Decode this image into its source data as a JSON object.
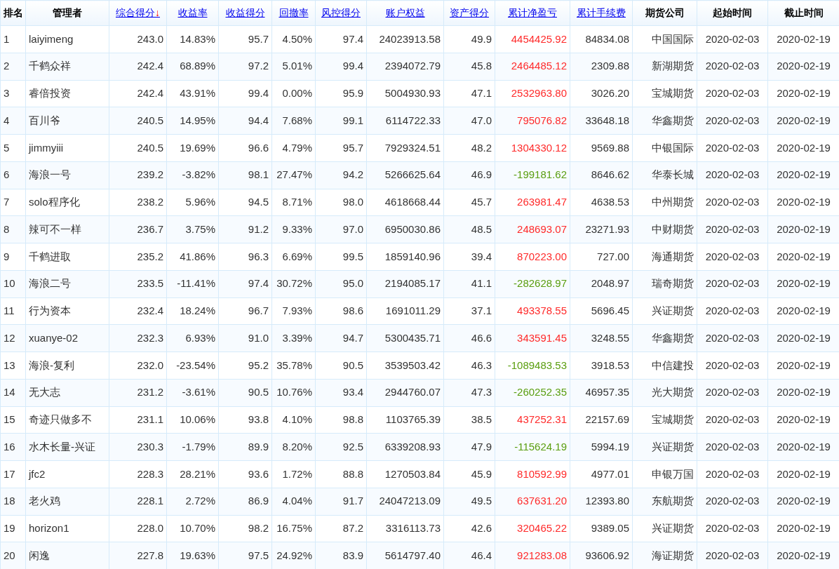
{
  "table": {
    "columns": [
      {
        "label": "排名",
        "link": false
      },
      {
        "label": "管理者",
        "link": false
      },
      {
        "label": "综合得分",
        "link": true,
        "sort_arrow": "↓"
      },
      {
        "label": "收益率",
        "link": true
      },
      {
        "label": "收益得分",
        "link": true
      },
      {
        "label": "回撤率",
        "link": true
      },
      {
        "label": "风控得分",
        "link": true
      },
      {
        "label": "账户权益",
        "link": true
      },
      {
        "label": "资产得分",
        "link": true
      },
      {
        "label": "累计净盈亏",
        "link": true
      },
      {
        "label": "累计手续费",
        "link": true
      },
      {
        "label": "期货公司",
        "link": false
      },
      {
        "label": "起始时间",
        "link": false
      },
      {
        "label": "截止时间",
        "link": false
      }
    ],
    "rows": [
      {
        "cells": [
          "1",
          "laiyimeng",
          "243.0",
          "14.83%",
          "95.7",
          "4.50%",
          "97.4",
          "24023913.58",
          "49.9",
          "4454425.92",
          "84834.08",
          "中国国际",
          "2020-02-03",
          "2020-02-19"
        ],
        "color": "#ff2a2a"
      },
      {
        "cells": [
          "2",
          "千鹤众祥",
          "242.4",
          "68.89%",
          "97.2",
          "5.01%",
          "99.4",
          "2394072.79",
          "45.8",
          "2464485.12",
          "2309.88",
          "新湖期货",
          "2020-02-03",
          "2020-02-19"
        ],
        "color": "#ff2a2a"
      },
      {
        "cells": [
          "3",
          "睿倍投资",
          "242.4",
          "43.91%",
          "99.4",
          "0.00%",
          "95.9",
          "5004930.93",
          "47.1",
          "2532963.80",
          "3026.20",
          "宝城期货",
          "2020-02-03",
          "2020-02-19"
        ],
        "color": "#ff2a2a"
      },
      {
        "cells": [
          "4",
          "百川爷",
          "240.5",
          "14.95%",
          "94.4",
          "7.68%",
          "99.1",
          "6114722.33",
          "47.0",
          "795076.82",
          "33648.18",
          "华鑫期货",
          "2020-02-03",
          "2020-02-19"
        ],
        "color": "#ff2a2a"
      },
      {
        "cells": [
          "5",
          "jimmyiii",
          "240.5",
          "19.69%",
          "96.6",
          "4.79%",
          "95.7",
          "7929324.51",
          "48.2",
          "1304330.12",
          "9569.88",
          "中银国际",
          "2020-02-03",
          "2020-02-19"
        ],
        "color": "#ff2a2a"
      },
      {
        "cells": [
          "6",
          "海浪一号",
          "239.2",
          "-3.82%",
          "98.1",
          "27.47%",
          "94.2",
          "5266625.64",
          "46.9",
          "-199181.62",
          "8646.62",
          "华泰长城",
          "2020-02-03",
          "2020-02-19"
        ],
        "color": "#5a9e0f"
      },
      {
        "cells": [
          "7",
          "solo程序化",
          "238.2",
          "5.96%",
          "94.5",
          "8.71%",
          "98.0",
          "4618668.44",
          "45.7",
          "263981.47",
          "4638.53",
          "中州期货",
          "2020-02-03",
          "2020-02-19"
        ],
        "color": "#ff2a2a"
      },
      {
        "cells": [
          "8",
          "辣可不一样",
          "236.7",
          "3.75%",
          "91.2",
          "9.33%",
          "97.0",
          "6950030.86",
          "48.5",
          "248693.07",
          "23271.93",
          "中财期货",
          "2020-02-03",
          "2020-02-19"
        ],
        "color": "#ff2a2a"
      },
      {
        "cells": [
          "9",
          "千鹤进取",
          "235.2",
          "41.86%",
          "96.3",
          "6.69%",
          "99.5",
          "1859140.96",
          "39.4",
          "870223.00",
          "727.00",
          "海通期货",
          "2020-02-03",
          "2020-02-19"
        ],
        "color": "#ff2a2a"
      },
      {
        "cells": [
          "10",
          "海浪二号",
          "233.5",
          "-11.41%",
          "97.4",
          "30.72%",
          "95.0",
          "2194085.17",
          "41.1",
          "-282628.97",
          "2048.97",
          "瑞奇期货",
          "2020-02-03",
          "2020-02-19"
        ],
        "color": "#5a9e0f"
      },
      {
        "cells": [
          "11",
          "行为资本",
          "232.4",
          "18.24%",
          "96.7",
          "7.93%",
          "98.6",
          "1691011.29",
          "37.1",
          "493378.55",
          "5696.45",
          "兴证期货",
          "2020-02-03",
          "2020-02-19"
        ],
        "color": "#ff2a2a"
      },
      {
        "cells": [
          "12",
          "xuanye-02",
          "232.3",
          "6.93%",
          "91.0",
          "3.39%",
          "94.7",
          "5300435.71",
          "46.6",
          "343591.45",
          "3248.55",
          "华鑫期货",
          "2020-02-03",
          "2020-02-19"
        ],
        "color": "#ff2a2a"
      },
      {
        "cells": [
          "13",
          "海浪-复利",
          "232.0",
          "-23.54%",
          "95.2",
          "35.78%",
          "90.5",
          "3539503.42",
          "46.3",
          "-1089483.53",
          "3918.53",
          "中信建投",
          "2020-02-03",
          "2020-02-19"
        ],
        "color": "#5a9e0f"
      },
      {
        "cells": [
          "14",
          "无大志",
          "231.2",
          "-3.61%",
          "90.5",
          "10.76%",
          "93.4",
          "2944760.07",
          "47.3",
          "-260252.35",
          "46957.35",
          "光大期货",
          "2020-02-03",
          "2020-02-19"
        ],
        "color": "#5a9e0f"
      },
      {
        "cells": [
          "15",
          "奇迹只做多不",
          "231.1",
          "10.06%",
          "93.8",
          "4.10%",
          "98.8",
          "1103765.39",
          "38.5",
          "437252.31",
          "22157.69",
          "宝城期货",
          "2020-02-03",
          "2020-02-19"
        ],
        "color": "#ff2a2a"
      },
      {
        "cells": [
          "16",
          "水木长量-兴证",
          "230.3",
          "-1.79%",
          "89.9",
          "8.20%",
          "92.5",
          "6339208.93",
          "47.9",
          "-115624.19",
          "5994.19",
          "兴证期货",
          "2020-02-03",
          "2020-02-19"
        ],
        "color": "#5a9e0f"
      },
      {
        "cells": [
          "17",
          "jfc2",
          "228.3",
          "28.21%",
          "93.6",
          "1.72%",
          "88.8",
          "1270503.84",
          "45.9",
          "810592.99",
          "4977.01",
          "申银万国",
          "2020-02-03",
          "2020-02-19"
        ],
        "color": "#ff2a2a"
      },
      {
        "cells": [
          "18",
          "老火鸡",
          "228.1",
          "2.72%",
          "86.9",
          "4.04%",
          "91.7",
          "24047213.09",
          "49.5",
          "637631.20",
          "12393.80",
          "东航期货",
          "2020-02-03",
          "2020-02-19"
        ],
        "color": "#ff2a2a"
      },
      {
        "cells": [
          "19",
          "horizon1",
          "228.0",
          "10.70%",
          "98.2",
          "16.75%",
          "87.2",
          "3316113.73",
          "42.6",
          "320465.22",
          "9389.05",
          "兴证期货",
          "2020-02-03",
          "2020-02-19"
        ],
        "color": "#ff2a2a"
      },
      {
        "cells": [
          "20",
          "闲逸",
          "227.8",
          "19.63%",
          "97.5",
          "24.92%",
          "83.9",
          "5614797.40",
          "46.4",
          "921283.08",
          "93606.92",
          "海证期货",
          "2020-02-03",
          "2020-02-19"
        ],
        "color": "#ff2a2a"
      }
    ]
  }
}
